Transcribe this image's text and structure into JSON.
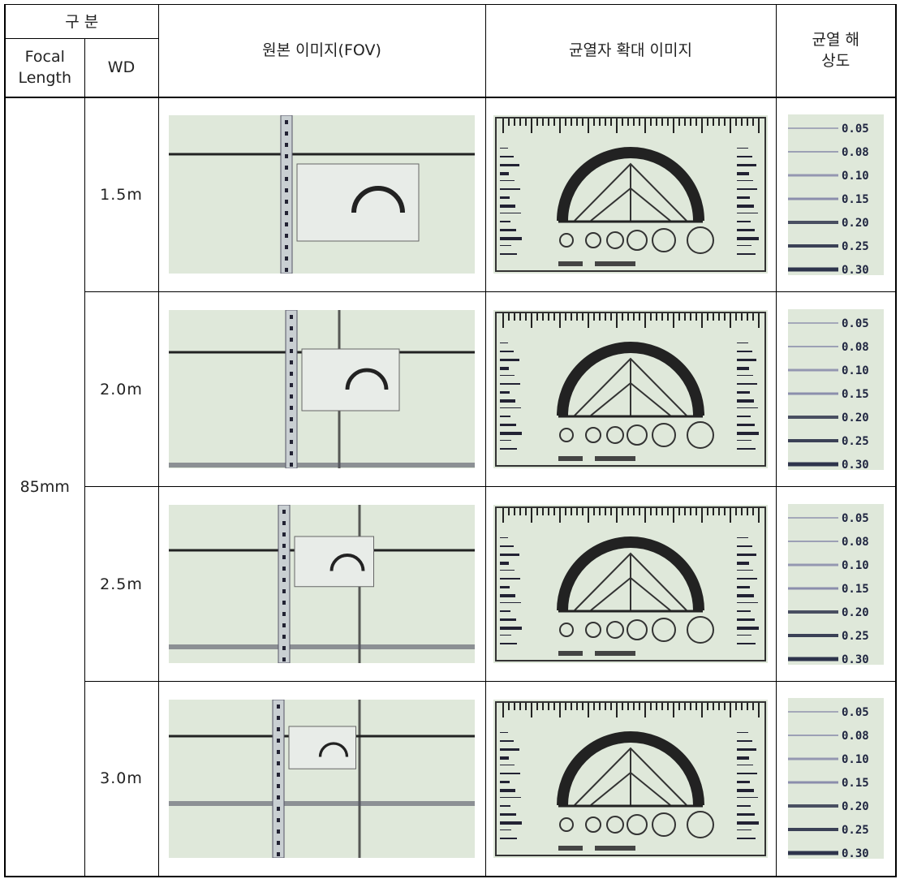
{
  "header": {
    "category": "구 분",
    "focal_length": "Focal Length",
    "wd": "WD",
    "original_image": "원본 이미지(FOV)",
    "crack_gauge_zoom": "균열자 확대 이미지",
    "crack_resolution": "균열 해상도"
  },
  "focal_length_value": "85mm",
  "rows": [
    {
      "wd": "1.5m"
    },
    {
      "wd": "2.0m"
    },
    {
      "wd": "2.5m"
    },
    {
      "wd": "3.0m"
    }
  ],
  "resolution_labels": [
    "0.05",
    "0.08",
    "0.10",
    "0.15",
    "0.20",
    "0.25",
    "0.30"
  ],
  "colors": {
    "image_background": "#dfe8da",
    "gauge_dark": "#1f2540",
    "line_purple": "#6a6a9a"
  }
}
